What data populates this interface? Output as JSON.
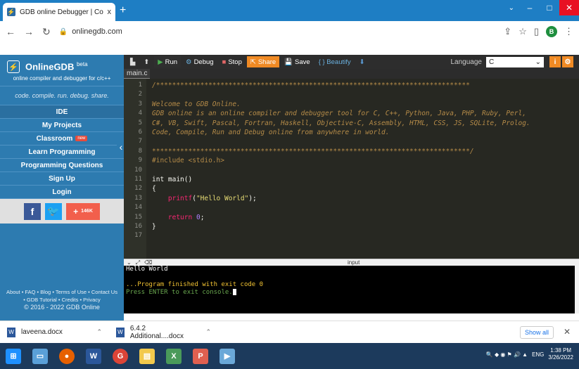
{
  "browser": {
    "tab_title": "GDB online Debugger | Compiler",
    "tab_close": "x",
    "new_tab": "+",
    "url": "onlinegdb.com",
    "profile_initial": "B",
    "window_controls": [
      "–",
      "□",
      "✕"
    ]
  },
  "sidebar": {
    "brand": "OnlineGDB",
    "brand_sup": "beta",
    "tagline": "online compiler and debugger for c/c++",
    "motto": "code. compile. run. debug. share.",
    "items": [
      {
        "label": "IDE"
      },
      {
        "label": "My Projects"
      },
      {
        "label": "Classroom",
        "badge": "new"
      },
      {
        "label": "Learn Programming"
      },
      {
        "label": "Programming Questions"
      },
      {
        "label": "Sign Up"
      },
      {
        "label": "Login"
      }
    ],
    "social_count": "146K",
    "footer_line1": "About • FAQ • Blog • Terms of Use • Contact Us",
    "footer_line2": "• GDB Tutorial • Credits • Privacy",
    "copyright": "© 2016 - 2022 GDB Online"
  },
  "toolbar": {
    "run": "Run",
    "debug": "Debug",
    "stop": "Stop",
    "share": "Share",
    "save": "Save",
    "beautify": "{ } Beautify",
    "language_label": "Language",
    "language_value": "C"
  },
  "editor": {
    "file_tab": "main.c",
    "lines": [
      {
        "n": "1",
        "text": "/******************************************************************************",
        "cls": "c-comment"
      },
      {
        "n": "2",
        "text": "",
        "cls": "c-comment"
      },
      {
        "n": "3",
        "text": "Welcome to GDB Online.",
        "cls": "c-comment"
      },
      {
        "n": "4",
        "text": "GDB online is an online compiler and debugger tool for C, C++, Python, Java, PHP, Ruby, Perl,",
        "cls": "c-comment"
      },
      {
        "n": "5",
        "text": "C#, VB, Swift, Pascal, Fortran, Haskell, Objective-C, Assembly, HTML, CSS, JS, SQLite, Prolog.",
        "cls": "c-comment"
      },
      {
        "n": "6",
        "text": "Code, Compile, Run and Debug online from anywhere in world.",
        "cls": "c-comment"
      },
      {
        "n": "7",
        "text": "",
        "cls": "c-comment"
      },
      {
        "n": "8",
        "text": "*******************************************************************************/",
        "cls": "c-comment"
      },
      {
        "n": "9",
        "text": "#include <stdio.h>",
        "cls": "c-pre"
      },
      {
        "n": "10",
        "text": "",
        "cls": ""
      },
      {
        "n": "11",
        "text": "int main()",
        "cls": ""
      },
      {
        "n": "12",
        "text": "{",
        "cls": ""
      },
      {
        "n": "13",
        "text": "",
        "cls": "",
        "printf": true
      },
      {
        "n": "14",
        "text": "",
        "cls": ""
      },
      {
        "n": "15",
        "text": "",
        "cls": "",
        "ret": true
      },
      {
        "n": "16",
        "text": "}",
        "cls": ""
      },
      {
        "n": "17",
        "text": "",
        "cls": ""
      }
    ],
    "printf_fn": "printf",
    "printf_str": "\"Hello World\"",
    "printf_tail": ");",
    "return_kw": "return",
    "return_val": "0",
    "return_tail": ";"
  },
  "console": {
    "io_label": "input",
    "output": "Hello World",
    "exit_line": "...Program finished with exit code 0",
    "enter_line": "Press ENTER to exit console."
  },
  "downloads": {
    "items": [
      {
        "name": "laveena.docx"
      },
      {
        "name": "6.4.2 Additional....docx"
      }
    ],
    "show_all": "Show all",
    "close": "✕"
  },
  "taskbar": {
    "lang": "ENG",
    "time": "1:38 PM",
    "date": "3/26/2022"
  }
}
